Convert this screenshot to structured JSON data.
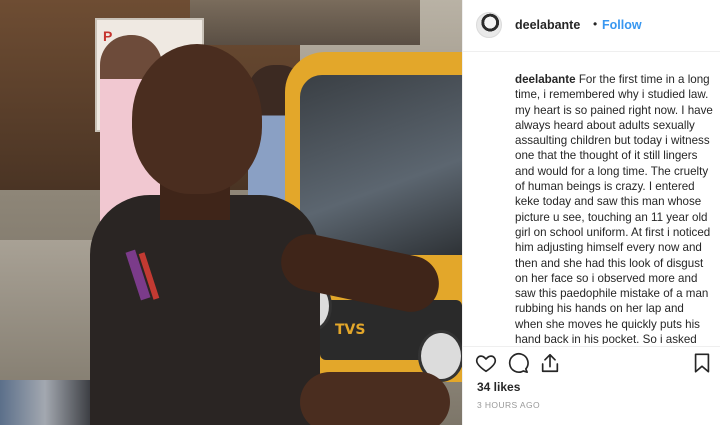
{
  "post": {
    "username": "deelabante",
    "follow_label": "Follow",
    "separator": "•",
    "caption_username": "deelabante",
    "caption_text": "For the first time in a long time, i remembered why i studied law. my heart is so pained right now. I have always heard about adults sexually assaulting children but today i witness one that the thought of it still lingers and would for a long time. The cruelty of human beings is crazy. I entered keke today and saw this man whose picture u see, touching an 11 year old girl on school uniform. At first i noticed him adjusting himself every now and then and she had this look of disgust on her face so i observed more and saw this paedophile mistake of a man rubbing his hands on her lap and when she moves he quickly puts his hand back in his pocket. So i asked her if he was disturbing her and she confirmed it. now i didnt have to bcos",
    "likes": "34 likes",
    "timestamp": "3 HOURS AGO"
  },
  "photo": {
    "sign_text": "P",
    "vehicle_brand": "TVS"
  },
  "icons": {
    "like": "heart-icon",
    "comment": "comment-icon",
    "share": "share-icon",
    "save": "bookmark-icon"
  },
  "colors": {
    "follow": "#3897f0",
    "text": "#262626",
    "muted": "#999999",
    "border": "#efefef"
  }
}
